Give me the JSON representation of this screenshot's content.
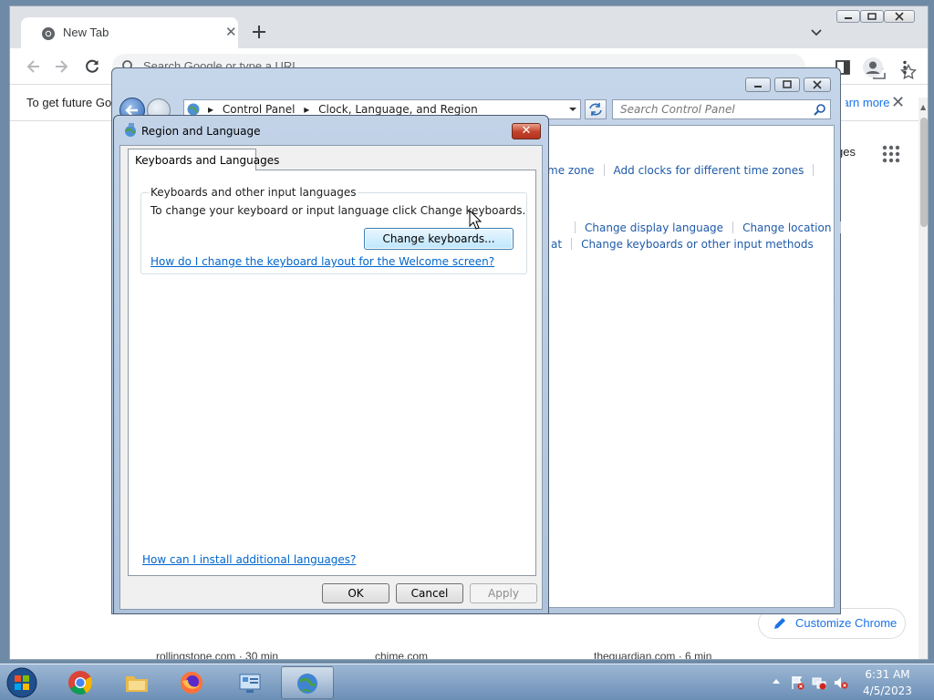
{
  "chrome": {
    "tab_title": "New Tab",
    "tab_close": "✕",
    "omnibox_placeholder": "Search Google or type a URL",
    "infobar_text": "To get future Go",
    "infobar_link": "Learn more",
    "infobar_close": "✕",
    "ntp_images_label": "ges",
    "customize_label": "Customize Chrome",
    "tiles": [
      "rollingstone.com · 30 min",
      "chime.com",
      "theguardian.com · 6 min"
    ]
  },
  "control_panel": {
    "breadcrumb": [
      "Control Panel",
      "Clock, Language, and Region"
    ],
    "search_placeholder": "Search Control Panel",
    "links_row1": [
      "me zone",
      "Add clocks for different time zones"
    ],
    "links_row2": [
      "Change display language",
      "Change location"
    ],
    "links_row3": [
      "at",
      "Change keyboards or other input methods"
    ]
  },
  "region_dialog": {
    "title": "Region and Language",
    "close_label": "✕",
    "tab_label": "Keyboards and Languages",
    "group_caption": "Keyboards and other input languages",
    "instruction": "To change your keyboard or input language click Change keyboards.",
    "change_keyboards_label": "Change keyboards...",
    "help_link_welcome": "How do I change the keyboard layout for the Welcome screen?",
    "help_link_install": "How can I install additional languages?",
    "ok_label": "OK",
    "cancel_label": "Cancel",
    "apply_label": "Apply"
  },
  "taskbar": {
    "apps": [
      "chrome-icon",
      "explorer-icon",
      "firefox-icon",
      "control-panel-icon",
      "region-globe-icon"
    ],
    "time": "6:31 AM",
    "date": "4/5/2023"
  }
}
